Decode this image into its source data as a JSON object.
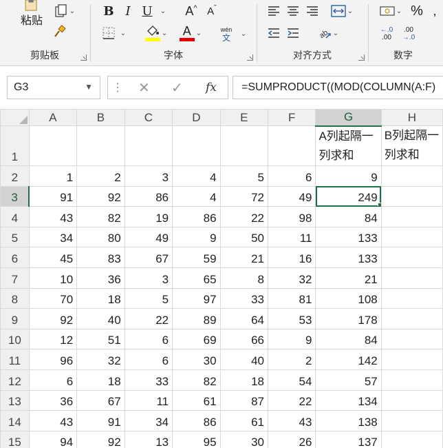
{
  "ribbon": {
    "clipboard": {
      "paste_label": "粘贴",
      "group_label": "剪贴板"
    },
    "font": {
      "bold": "B",
      "italic": "I",
      "underline": "U",
      "grow": "A",
      "shrink": "A",
      "font_color_letter": "A",
      "wen_top": "wén",
      "wen_bottom": "文",
      "group_label": "字体",
      "highlight_color": "#ffff00",
      "font_color": "#e00000"
    },
    "alignment": {
      "group_label": "对齐方式"
    },
    "number": {
      "percent": "%",
      "inc_decimal_top": "←.0",
      "inc_decimal_bottom": ".00",
      "dec_decimal_top": ".00",
      "dec_decimal_bottom": "→.0",
      "group_label": "数字"
    }
  },
  "formula_bar": {
    "name_box": "G3",
    "fx_label": "fx",
    "formula": "=SUMPRODUCT((MOD(COLUMN(A:F)"
  },
  "sheet": {
    "columns": [
      "A",
      "B",
      "C",
      "D",
      "E",
      "F",
      "G",
      "H"
    ],
    "selected_column": "G",
    "selected_row": "3",
    "header_row": {
      "row_number": "1",
      "g_text": "A列起隔一列求和",
      "h_text": "B列起隔一列求和"
    },
    "rows": [
      {
        "n": "2",
        "values": [
          "1",
          "2",
          "3",
          "4",
          "5",
          "6",
          "9",
          ""
        ]
      },
      {
        "n": "3",
        "values": [
          "91",
          "92",
          "86",
          "4",
          "72",
          "49",
          "249",
          ""
        ]
      },
      {
        "n": "4",
        "values": [
          "43",
          "82",
          "19",
          "86",
          "22",
          "98",
          "84",
          ""
        ]
      },
      {
        "n": "5",
        "values": [
          "34",
          "80",
          "49",
          "9",
          "50",
          "11",
          "133",
          ""
        ]
      },
      {
        "n": "6",
        "values": [
          "45",
          "83",
          "67",
          "59",
          "21",
          "16",
          "133",
          ""
        ]
      },
      {
        "n": "7",
        "values": [
          "10",
          "36",
          "3",
          "65",
          "8",
          "32",
          "21",
          ""
        ]
      },
      {
        "n": "8",
        "values": [
          "70",
          "18",
          "5",
          "97",
          "33",
          "81",
          "108",
          ""
        ]
      },
      {
        "n": "9",
        "values": [
          "92",
          "40",
          "22",
          "89",
          "64",
          "53",
          "178",
          ""
        ]
      },
      {
        "n": "10",
        "values": [
          "12",
          "51",
          "6",
          "69",
          "66",
          "9",
          "84",
          ""
        ]
      },
      {
        "n": "11",
        "values": [
          "96",
          "32",
          "6",
          "30",
          "40",
          "2",
          "142",
          ""
        ]
      },
      {
        "n": "12",
        "values": [
          "6",
          "18",
          "33",
          "82",
          "18",
          "54",
          "57",
          ""
        ]
      },
      {
        "n": "13",
        "values": [
          "36",
          "67",
          "11",
          "61",
          "87",
          "22",
          "134",
          ""
        ]
      },
      {
        "n": "14",
        "values": [
          "43",
          "91",
          "34",
          "86",
          "61",
          "43",
          "138",
          ""
        ]
      },
      {
        "n": "15",
        "values": [
          "94",
          "92",
          "13",
          "95",
          "30",
          "26",
          "137",
          ""
        ]
      }
    ],
    "accent_color": "#1f7145"
  }
}
